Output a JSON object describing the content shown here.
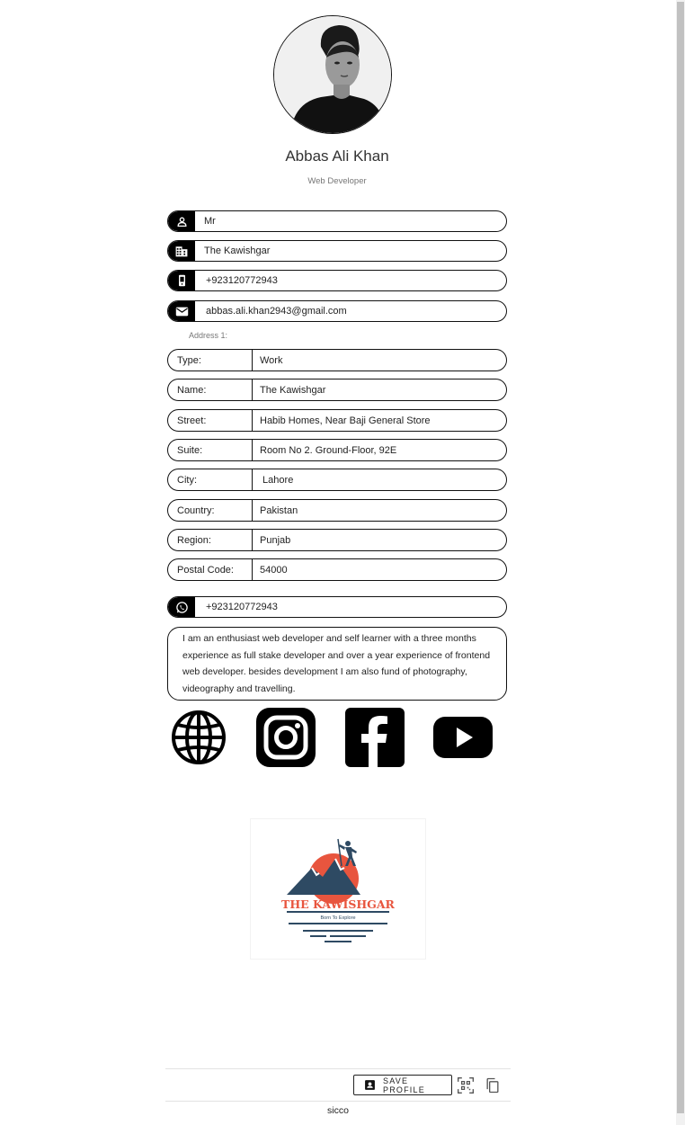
{
  "profile": {
    "name": "Abbas Ali Khan",
    "job_title": "Web Developer"
  },
  "contact": {
    "salutation": "Mr",
    "organization": "The Kawishgar",
    "phone": "+923120772943",
    "email": "abbas.ali.khan2943@gmail.com",
    "whatsapp": "+923120772943"
  },
  "address": {
    "heading": "Address 1:",
    "fields": [
      {
        "label": "Type:",
        "value": "Work"
      },
      {
        "label": "Name:",
        "value": "The Kawishgar"
      },
      {
        "label": "Street:",
        "value": "Habib Homes, Near Baji General Store"
      },
      {
        "label": "Suite:",
        "value": "Room No 2. Ground-Floor, 92E"
      },
      {
        "label": "City:",
        "value": " Lahore"
      },
      {
        "label": "Country:",
        "value": "Pakistan"
      },
      {
        "label": "Region:",
        "value": "Punjab"
      },
      {
        "label": "Postal Code:",
        "value": "54000"
      }
    ]
  },
  "bio": "I am an enthusiast web developer and self learner with a three months experience as full stake developer and over a year experience of frontend web developer. besides development I am also fund of photography, videography and travelling.",
  "socials": [
    "globe-icon",
    "instagram-icon",
    "facebook-icon",
    "youtube-icon"
  ],
  "logo": {
    "title": "THE KAWISHGAR",
    "tagline": "Born To Explore",
    "colors": {
      "sun": "#e8553e",
      "mountain": "#2e4a63"
    }
  },
  "footer": {
    "save_label": "SAVE PROFILE",
    "brand": "sicco"
  }
}
